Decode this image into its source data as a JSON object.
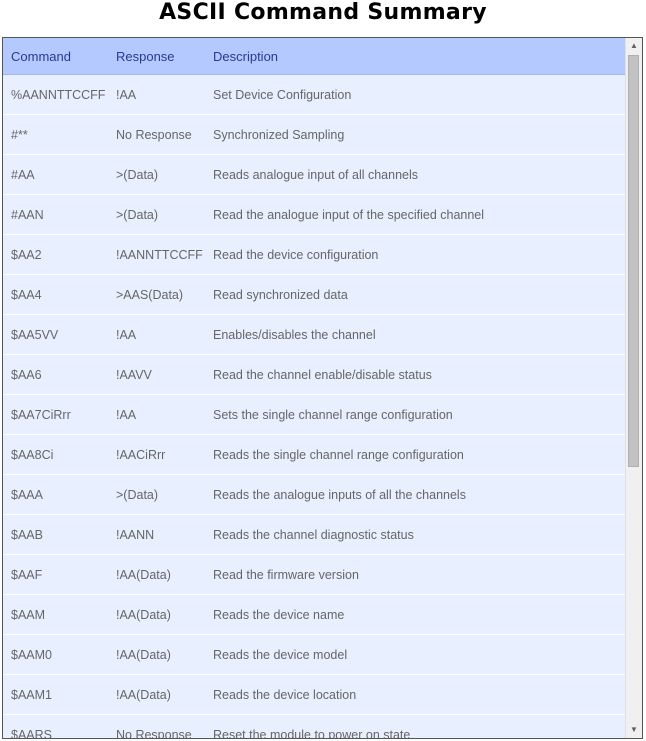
{
  "title": "ASCII Command Summary",
  "table": {
    "headers": [
      "Command",
      "Response",
      "Description"
    ],
    "rows": [
      [
        "%AANNTTCCFF",
        "!AA",
        "Set Device Configuration"
      ],
      [
        "#**",
        "No Response",
        "Synchronized Sampling"
      ],
      [
        "#AA",
        ">(Data)",
        "Reads analogue input of all channels"
      ],
      [
        "#AAN",
        ">(Data)",
        "Read the analogue input of the specified channel"
      ],
      [
        "$AA2",
        "!AANNTTCCFF",
        "Read the device configuration"
      ],
      [
        "$AA4",
        ">AAS(Data)",
        "Read synchronized data"
      ],
      [
        "$AA5VV",
        "!AA",
        "Enables/disables the channel"
      ],
      [
        "$AA6",
        "!AAVV",
        "Read the channel enable/disable status"
      ],
      [
        "$AA7CiRrr",
        "!AA",
        "Sets the single channel range configuration"
      ],
      [
        "$AA8Ci",
        "!AACiRrr",
        "Reads the single channel range configuration"
      ],
      [
        "$AAA",
        ">(Data)",
        "Reads the analogue inputs of all the channels"
      ],
      [
        "$AAB",
        "!AANN",
        "Reads the channel diagnostic status"
      ],
      [
        "$AAF",
        "!AA(Data)",
        "Read the firmware version"
      ],
      [
        "$AAM",
        "!AA(Data)",
        "Reads the device name"
      ],
      [
        "$AAM0",
        "!AA(Data)",
        "Reads the device model"
      ],
      [
        "$AAM1",
        "!AA(Data)",
        "Reads the device location"
      ],
      [
        "$AARS",
        "No Response",
        "Reset the module to power on state"
      ]
    ]
  },
  "scrollbar": {
    "up_icon": "scroll-up-arrow-icon",
    "down_icon": "scroll-down-arrow-icon",
    "up_glyph": "▲",
    "down_glyph": "▼"
  },
  "colors": {
    "header_bg": "#b3c9ff",
    "header_text": "#2b3a8f",
    "row_bg": "#e8efff",
    "cell_text": "#666666"
  }
}
